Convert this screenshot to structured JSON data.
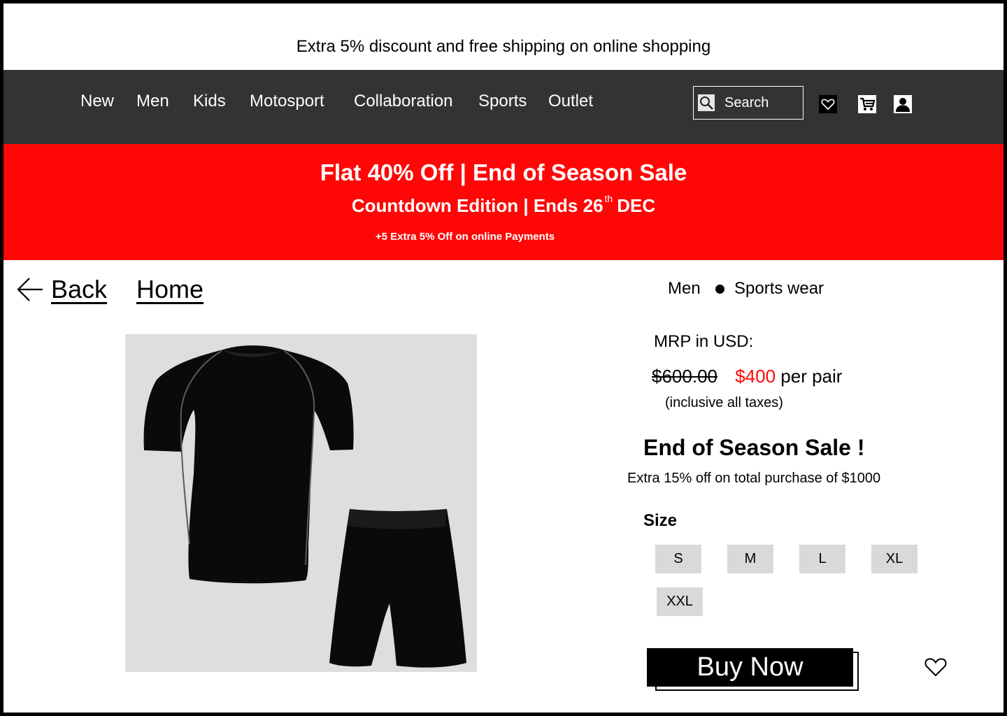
{
  "announcement": "Extra 5% discount and free shipping on online shopping",
  "nav": {
    "items": [
      "New",
      "Men",
      "Kids",
      "Motosport",
      "Collaboration",
      "Sports",
      "Outlet"
    ],
    "search_label": "Search",
    "icons": [
      "search-icon",
      "heart-icon",
      "cart-icon",
      "user-icon"
    ]
  },
  "promo": {
    "title": "Flat 40% Off | End of Season Sale",
    "sub_before": "Countdown Edition | Ends 26",
    "sub_sup": "th",
    "sub_after": "DEC",
    "note": "+5 Extra 5% Off on online Payments",
    "color": "#ff0707"
  },
  "navigation": {
    "back_label": "Back",
    "home_label": "Home"
  },
  "breadcrumb": {
    "category": "Men",
    "subcategory": "Sports wear"
  },
  "product": {
    "image_alt": "Black compression t-shirt and shorts set",
    "mrp_label": "MRP in USD:",
    "old_price": "$600.00",
    "new_price": "$400",
    "price_unit": "per pair",
    "tax_note": "(inclusive all taxes)",
    "sale_title": "End of Season Sale !",
    "sale_sub": "Extra 15% off on total purchase of $1000",
    "size_label": "Size",
    "sizes": [
      "S",
      "M",
      "L",
      "XL",
      "XXL"
    ],
    "buy_label": "Buy Now"
  }
}
